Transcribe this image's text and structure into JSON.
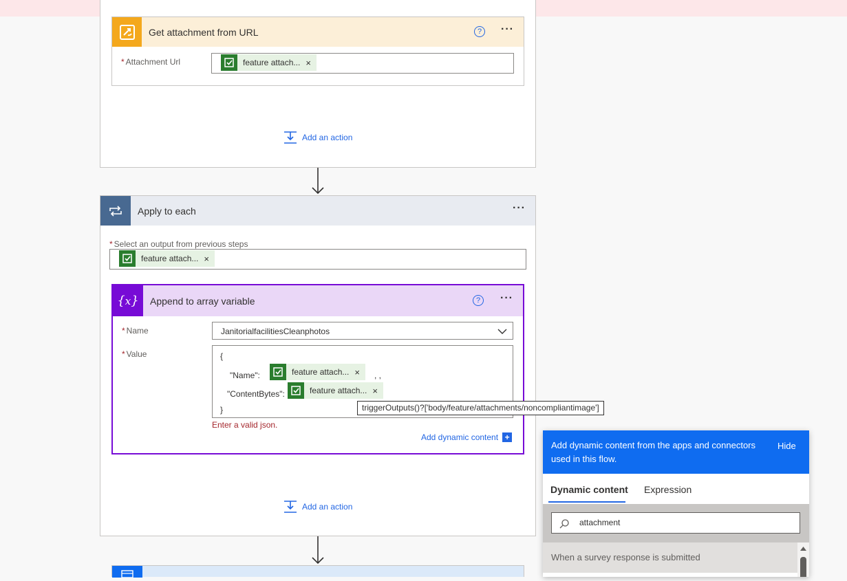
{
  "colors": {
    "accent": "#2266e3",
    "attachment_orange": "#f4a81d",
    "loop_blue": "#486991",
    "variable_purple": "#770bd6",
    "survey_green": "#2a7d2e",
    "panel_blue": "#0f6cf0",
    "error_red": "#a4262c"
  },
  "get_attachment": {
    "title": "Get attachment from URL",
    "icon": "attachment-sync-icon",
    "field_label": "Attachment Url",
    "token_label": "feature attach...",
    "add_action": "Add an action"
  },
  "apply_each": {
    "title": "Apply to each",
    "icon": "loop-icon",
    "field_label": "Select an output from previous steps",
    "token_label": "feature attach...",
    "add_action": "Add an action"
  },
  "append_var": {
    "title": "Append to array variable",
    "icon": "variable-icon",
    "name_label": "Name",
    "name_value": "JanitorialfacilitiesCleanphotos",
    "value_label": "Value",
    "json_open": "{",
    "json_name_key": "\"Name\":",
    "json_name_token": "feature attach...",
    "json_name_after": ",             ,",
    "json_content_key": "\"ContentBytes\":",
    "json_content_token": "feature attach...",
    "json_close": "}",
    "tooltip": "triggerOutputs()?['body/feature/attachments/noncompliantimage']",
    "error": "Enter a valid json.",
    "add_dynamic": "Add dynamic content"
  },
  "dynamic_panel": {
    "header": "Add dynamic content from the apps and connectors used in this flow.",
    "hide": "Hide",
    "tabs": [
      "Dynamic content",
      "Expression"
    ],
    "search_value": "attachment",
    "section": "When a survey response is submitted"
  }
}
